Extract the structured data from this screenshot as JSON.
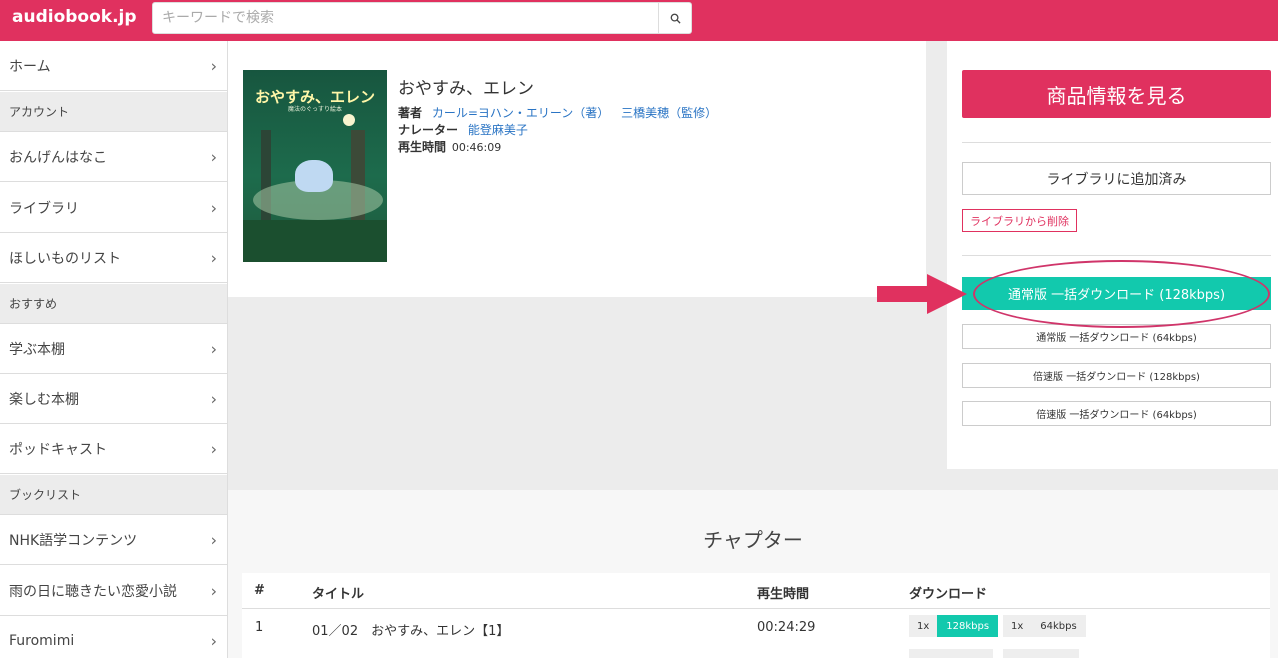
{
  "header": {
    "logo": "audiobook.jp",
    "search_placeholder": "キーワードで検索"
  },
  "sidebar": {
    "home": "ホーム",
    "section_account": "アカウント",
    "account_items": [
      "おんげんはなこ",
      "ライブラリ",
      "ほしいものリスト"
    ],
    "section_recommend": "おすすめ",
    "recommend_items": [
      "学ぶ本棚",
      "楽しむ本棚",
      "ポッドキャスト"
    ],
    "section_booklist": "ブックリスト",
    "booklist_items": [
      "NHK語学コンテンツ",
      "雨の日に聴きたい恋愛小説",
      "Furomimi"
    ]
  },
  "book": {
    "title": "おやすみ、エレン",
    "cover_title": "おやすみ、エレン",
    "cover_subtitle": "魔法のぐっすり絵本",
    "author_label": "著者",
    "authors": [
      "カール=ヨハン・エリーン（著）",
      "三橋美穂（監修）"
    ],
    "narrator_label": "ナレーター",
    "narrator": "能登麻美子",
    "duration_label": "再生時間",
    "duration": "00:46:09"
  },
  "actions": {
    "view_product": "商品情報を見る",
    "added_to_library": "ライブラリに追加済み",
    "remove_from_library": "ライブラリから削除",
    "download_primary": "通常版 一括ダウンロード (128kbps)",
    "download_options": [
      "通常版 一括ダウンロード (64kbps)",
      "倍速版 一括ダウンロード (128kbps)",
      "倍速版 一括ダウンロード (64kbps)"
    ]
  },
  "chapters": {
    "heading": "チャプター",
    "columns": [
      "#",
      "タイトル",
      "再生時間",
      "ダウンロード"
    ],
    "rows": [
      {
        "num": "1",
        "title": "01／02　おやすみ、エレン【1】",
        "duration": "00:24:29",
        "downloads": [
          {
            "speed": "1x",
            "quality": "128kbps"
          },
          {
            "speed": "1x",
            "quality": "64kbps"
          }
        ]
      }
    ]
  },
  "colors": {
    "brand": "#e0315f",
    "download_accent": "#12c9ad",
    "link": "#2a74c4"
  }
}
